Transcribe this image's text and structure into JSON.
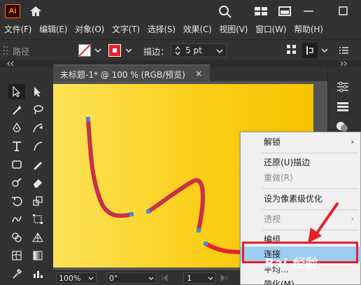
{
  "app": {
    "logo_text": "Ai",
    "accent": "#ff9a00"
  },
  "menubar": {
    "items": [
      "文件(F)",
      "编辑(E)",
      "对象(O)",
      "文字(T)",
      "选择(S)",
      "效果(C)",
      "视图(V)",
      "窗口(W)",
      "帮助(H)"
    ]
  },
  "controlbar": {
    "selection_label": "路径",
    "stroke_label": "描边：",
    "stroke_value": "5 pt"
  },
  "document": {
    "tab_title": "未标题-1* @ 100 % (RGB/预览)",
    "close_label": "×"
  },
  "statusbar": {
    "zoom": "100%",
    "rotation": "0°",
    "artboard": "1"
  },
  "context_menu": {
    "items": [
      {
        "label": "解锁",
        "disabled": false,
        "submenu": true
      },
      {
        "label": "还原(U)描边",
        "disabled": false,
        "submenu": false
      },
      {
        "label": "重做(R)",
        "disabled": true,
        "submenu": false
      },
      {
        "label": "设为像素级优化",
        "disabled": false,
        "submenu": false
      },
      {
        "label": "透视",
        "disabled": true,
        "submenu": true
      },
      {
        "label": "编组",
        "disabled": false,
        "submenu": false
      },
      {
        "label": "连接",
        "disabled": false,
        "submenu": false,
        "highlighted": true
      },
      {
        "label": "平均...",
        "disabled": false,
        "submenu": false
      },
      {
        "label": "简化(M)...",
        "disabled": false,
        "submenu": false
      }
    ],
    "highlight_color": "#9fcdf2"
  },
  "annotation": {
    "arrow_color": "#e8202a",
    "watermark_text": "Bai 经验"
  },
  "artwork": {
    "stroke_color": "#e8202a",
    "anchor_color": "#3d8fe0",
    "artboard_color": "#fbcf1a"
  }
}
